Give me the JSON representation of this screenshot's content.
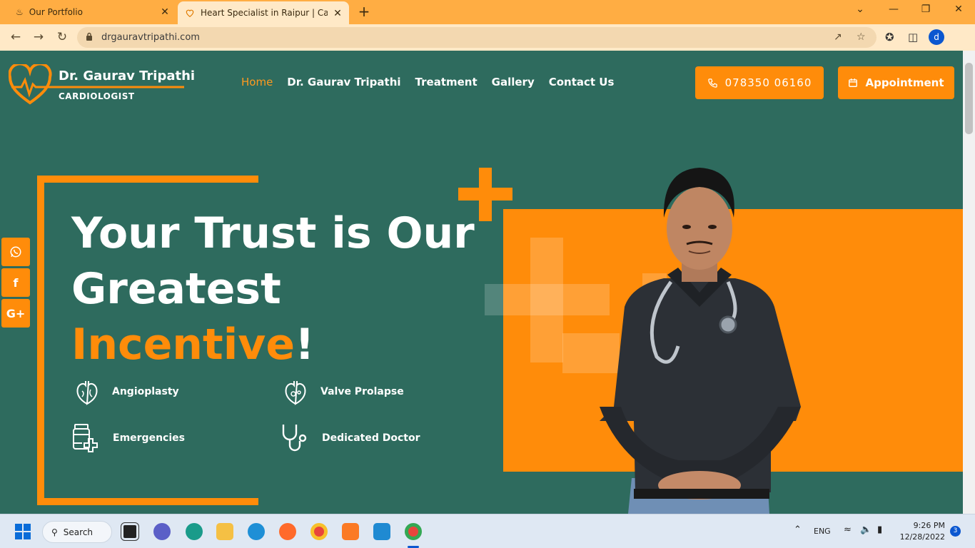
{
  "browser": {
    "tabs": [
      {
        "title": "Our Portfolio"
      },
      {
        "title": "Heart Specialist in Raipur | Cardic"
      }
    ],
    "url": "drgauravtripathi.com",
    "profile_initial": "d"
  },
  "site": {
    "logo": {
      "name": "Dr. Gaurav Tripathi",
      "subtitle": "CARDIOLOGIST"
    },
    "nav": [
      {
        "label": "Home",
        "active": true
      },
      {
        "label": "Dr. Gaurav Tripathi"
      },
      {
        "label": "Treatment"
      },
      {
        "label": "Gallery"
      },
      {
        "label": "Contact Us"
      }
    ],
    "phone_label": "078350 06160",
    "appointment_label": "Appointment",
    "hero": {
      "line1": "Your Trust is Our",
      "line2": "Greatest",
      "accent": "Incentive",
      "suffix": "!"
    },
    "features": [
      {
        "label": "Angioplasty",
        "icon": "heart-organ-icon"
      },
      {
        "label": "Valve Prolapse",
        "icon": "heart-valve-icon"
      },
      {
        "label": "Emergencies",
        "icon": "medicine-bottle-icon"
      },
      {
        "label": "Dedicated Doctor",
        "icon": "stethoscope-icon"
      }
    ],
    "social": [
      {
        "icon": "whatsapp-icon"
      },
      {
        "label": "f",
        "icon": "facebook-icon"
      },
      {
        "label": "G+",
        "icon": "google-plus-icon"
      }
    ],
    "colors": {
      "primary": "#ff8c0a",
      "background": "#2e6b5e",
      "text": "#ffffff"
    }
  },
  "taskbar": {
    "search_label": "Search",
    "language": "ENG",
    "time": "9:26 PM",
    "date": "12/28/2022",
    "notifications": "3"
  }
}
